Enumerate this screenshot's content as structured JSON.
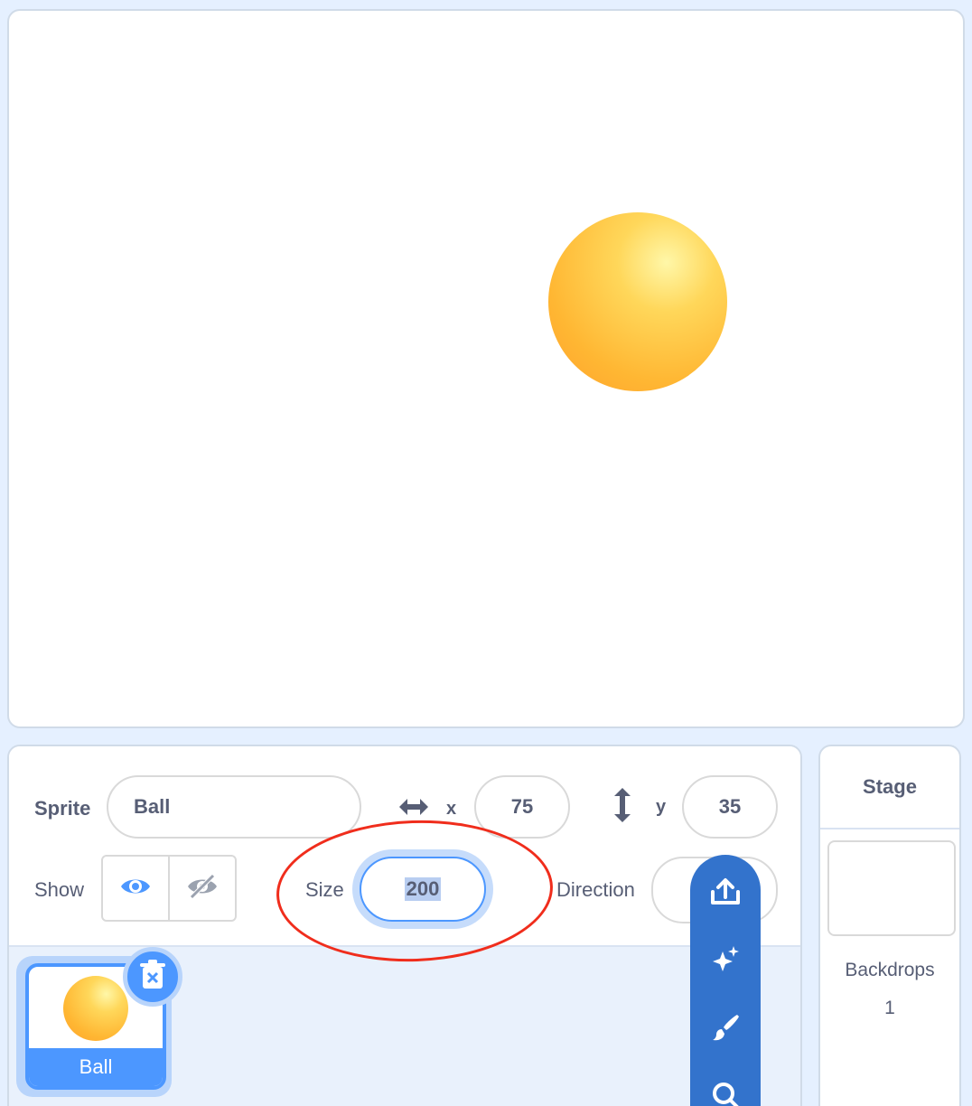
{
  "sprite_info": {
    "sprite_label": "Sprite",
    "sprite_name": "Ball",
    "x_label": "x",
    "x_value": "75",
    "y_label": "y",
    "y_value": "35",
    "show_label": "Show",
    "size_label": "Size",
    "size_value": "200",
    "direction_label": "Direction"
  },
  "sprites": [
    {
      "name": "Ball",
      "selected": true
    }
  ],
  "stage_panel": {
    "title": "Stage",
    "backdrops_label": "Backdrops",
    "backdrops_count": "1"
  },
  "icons": {
    "x_arrow": "horizontal-arrows-icon",
    "y_arrow": "vertical-arrows-icon",
    "show": "eye-icon",
    "hide": "eye-slash-icon",
    "delete": "trash-icon",
    "upload": "upload-icon",
    "surprise": "sparkle-icon",
    "paint": "paintbrush-icon",
    "search": "search-icon"
  },
  "colors": {
    "accent": "#4c97ff",
    "fab": "#3373cc",
    "annotation": "#f02d1c"
  }
}
